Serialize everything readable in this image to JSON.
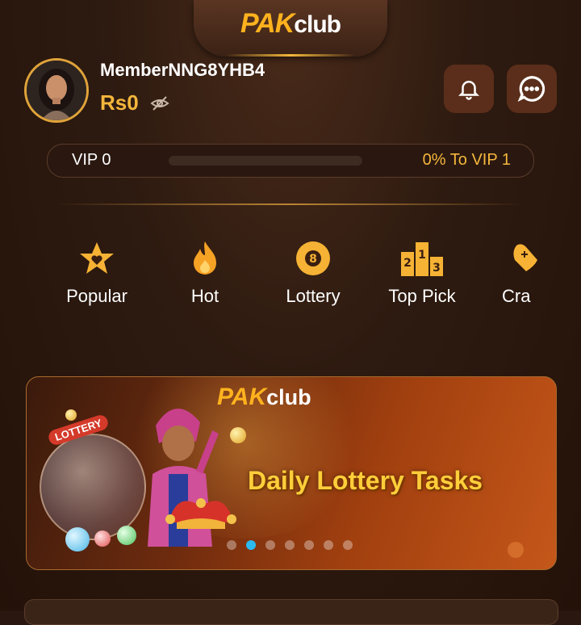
{
  "header": {
    "logo_part1": "PAK",
    "logo_part2": "club"
  },
  "user": {
    "name": "MemberNNG8YHB4",
    "balance": "Rs0"
  },
  "vip": {
    "current": "VIP 0",
    "progress_text": "0% To VIP 1",
    "progress_fraction": 0
  },
  "categories": [
    {
      "label": "Popular",
      "icon": "star-heart-icon"
    },
    {
      "label": "Hot",
      "icon": "flame-icon"
    },
    {
      "label": "Lottery",
      "icon": "lottery-ball-icon"
    },
    {
      "label": "Top Pick",
      "icon": "podium-icon"
    },
    {
      "label": "Cra",
      "icon": "crash-game-icon"
    }
  ],
  "banner": {
    "logo_part1": "PAK",
    "logo_part2": "club",
    "title": "Daily Lottery Tasks",
    "ball_label": "LOTTERY",
    "slide_count": 7,
    "active_slide": 1
  },
  "colors": {
    "accent": "#f4b63c",
    "background": "#2a1710",
    "dot_active": "#2bb9f0"
  }
}
